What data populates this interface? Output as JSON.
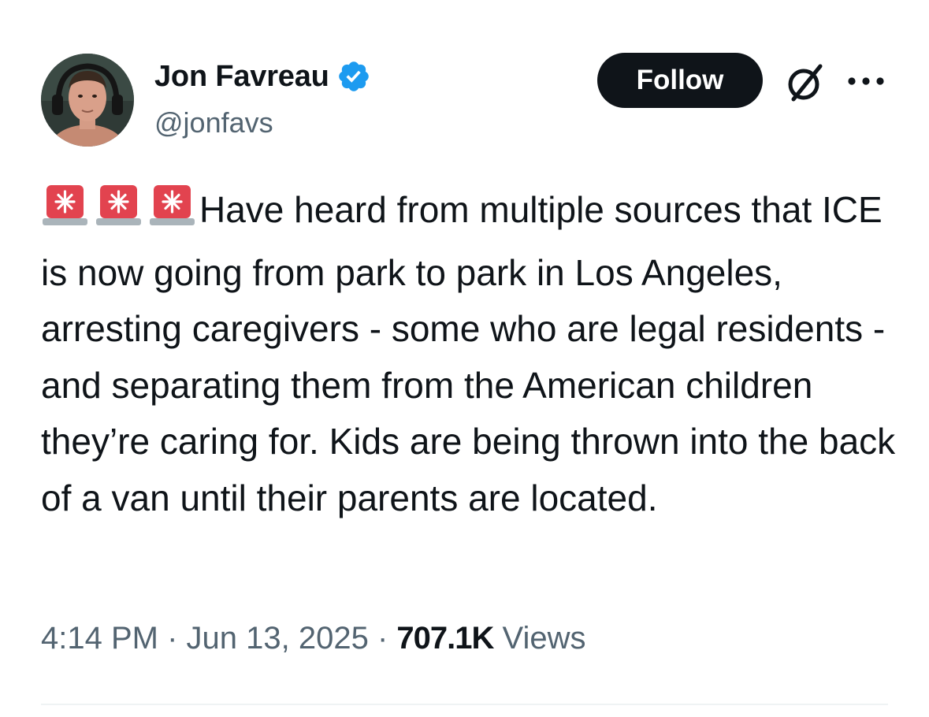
{
  "author": {
    "display_name": "Jon Favreau",
    "handle": "@jonfavs",
    "verified": true,
    "verified_color": "#1d9bf0"
  },
  "actions": {
    "follow_label": "Follow",
    "grok_icon": "grok-icon",
    "more_icon": "more-icon"
  },
  "tweet": {
    "emoji": [
      "police-car-light",
      "police-car-light",
      "police-car-light"
    ],
    "text": "Have heard from multiple sources that ICE is now going from park to park in Los Angeles, arresting caregivers - some who are legal residents - and separating them from the American children they’re caring for. Kids are being thrown into the back of a van until their parents are located."
  },
  "meta": {
    "time": "4:14 PM",
    "separator": " · ",
    "date": "Jun 13, 2025",
    "views_count": "707.1K",
    "views_label": "Views"
  },
  "colors": {
    "text_primary": "#0f1419",
    "text_secondary": "#536471",
    "follow_bg": "#0f1419",
    "siren_red": "#e2434f"
  }
}
